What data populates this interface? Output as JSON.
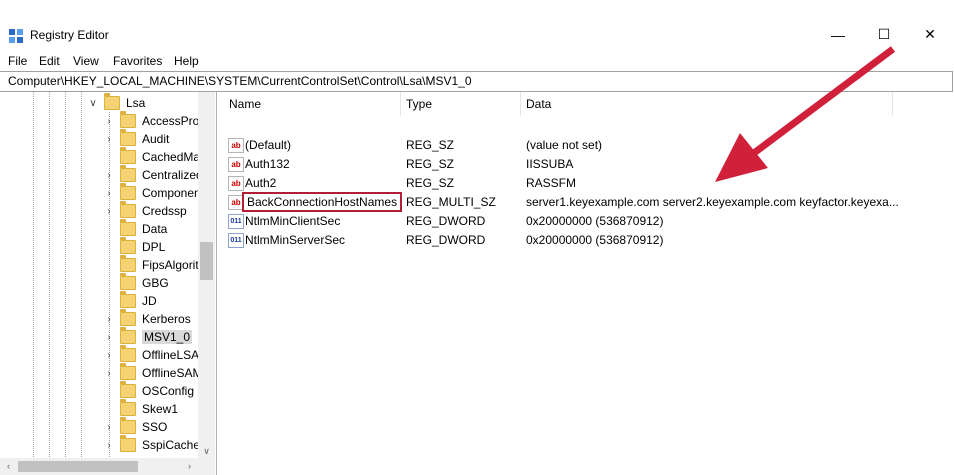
{
  "window": {
    "title": "Registry Editor",
    "controls": {
      "minimize": "—",
      "maximize": "☐",
      "close": "✕"
    }
  },
  "menu": [
    "File",
    "Edit",
    "View",
    "Favorites",
    "Help"
  ],
  "address": "Computer\\HKEY_LOCAL_MACHINE\\SYSTEM\\CurrentControlSet\\Control\\Lsa\\MSV1_0",
  "tree": {
    "parent": "Lsa",
    "children": [
      "AccessProv",
      "Audit",
      "CachedMac",
      "Centralized",
      "Componen",
      "Credssp",
      "Data",
      "DPL",
      "FipsAlgorit",
      "GBG",
      "JD",
      "Kerberos",
      "MSV1_0",
      "OfflineLSA",
      "OfflineSAM",
      "OSConfig",
      "Skew1",
      "SSO",
      "SspiCache"
    ],
    "selected": "MSV1_0"
  },
  "list": {
    "columns": [
      "Name",
      "Type",
      "Data"
    ],
    "rows": [
      {
        "name": "(Default)",
        "type": "REG_SZ",
        "data": "(value not set)",
        "icon": "string-value-icon"
      },
      {
        "name": "Auth132",
        "type": "REG_SZ",
        "data": "IISSUBA",
        "icon": "string-value-icon"
      },
      {
        "name": "Auth2",
        "type": "REG_SZ",
        "data": "RASSFM",
        "icon": "string-value-icon"
      },
      {
        "name": "BackConnectionHostNames",
        "type": "REG_MULTI_SZ",
        "data": "server1.keyexample.com server2.keyexample.com keyfactor.keyexa...",
        "icon": "string-value-icon"
      },
      {
        "name": "NtlmMinClientSec",
        "type": "REG_DWORD",
        "data": "0x20000000 (536870912)",
        "icon": "binary-value-icon"
      },
      {
        "name": "NtlmMinServerSec",
        "type": "REG_DWORD",
        "data": "0x20000000 (536870912)",
        "icon": "binary-value-icon"
      }
    ],
    "highlighted_row": "BackConnectionHostNames"
  },
  "annotation": {
    "arrow_color": "#d0203a"
  }
}
